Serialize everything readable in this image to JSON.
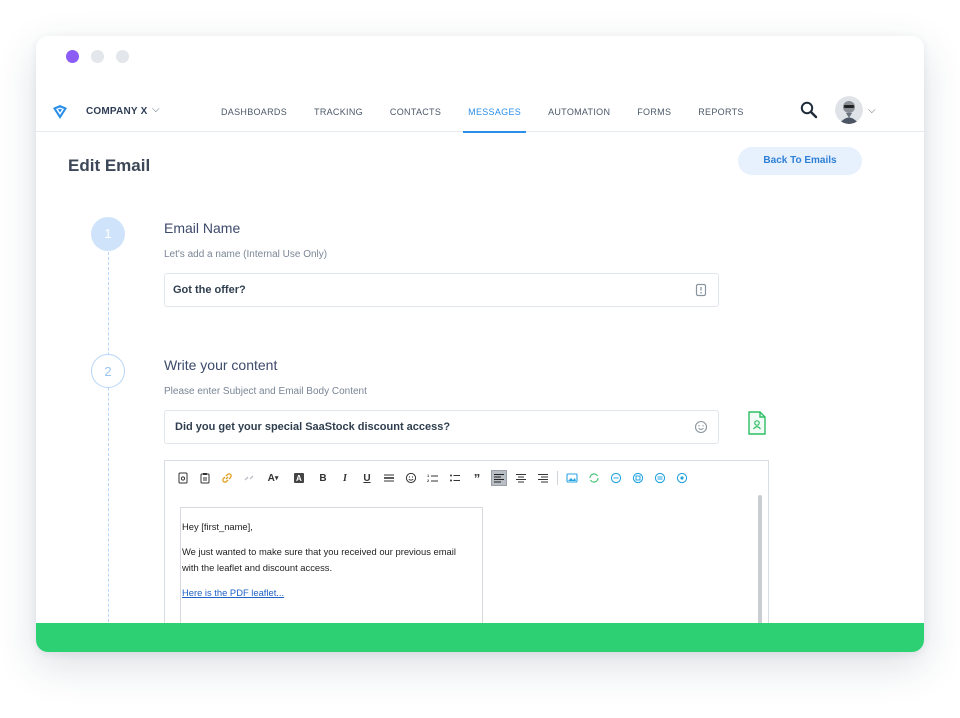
{
  "window": {
    "dots": [
      "#8b5cf6",
      "#e3e6ea",
      "#e3e6ea"
    ]
  },
  "topbar": {
    "company": "COMPANY X",
    "nav": [
      {
        "label": "DASHBOARDS",
        "active": false
      },
      {
        "label": "TRACKING",
        "active": false
      },
      {
        "label": "CONTACTS",
        "active": false
      },
      {
        "label": "MESSAGES",
        "active": true
      },
      {
        "label": "AUTOMATION",
        "active": false
      },
      {
        "label": "FORMS",
        "active": false
      },
      {
        "label": "REPORTS",
        "active": false
      }
    ]
  },
  "page": {
    "title": "Edit Email",
    "back_button": "Back To Emails"
  },
  "step1": {
    "number": "1",
    "title": "Email Name",
    "subtitle": "Let's add a name (Internal Use Only)",
    "value": "Got the offer?"
  },
  "step2": {
    "number": "2",
    "title": "Write your content",
    "subtitle": "Please enter Subject and Email Body Content",
    "subject": "Did you get your special SaaStock discount access?"
  },
  "editor": {
    "lines": [
      "Hey [first_name],",
      "We just wanted to make sure that you received our previous email",
      "with the leaflet and discount access."
    ],
    "link": "Here is the PDF leaflet..."
  },
  "colors": {
    "accent": "#2b8ee8",
    "green_bar": "#2dd072",
    "active_dot": "#8b5cf6"
  }
}
